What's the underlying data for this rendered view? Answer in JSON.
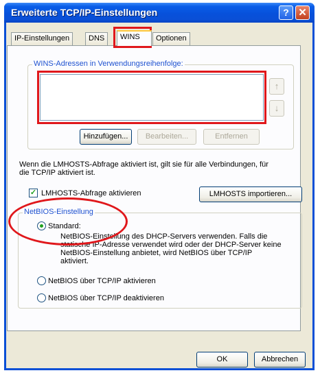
{
  "window": {
    "title": "Erweiterte TCP/IP-Einstellungen",
    "help_glyph": "?",
    "close_glyph": "✕"
  },
  "tabs": [
    {
      "label": "IP-Einstellungen",
      "active": false
    },
    {
      "label": "DNS",
      "active": false
    },
    {
      "label": "WINS",
      "active": true
    },
    {
      "label": "Optionen",
      "active": false
    }
  ],
  "wins": {
    "group_label": "WINS-Adressen in Verwendungsreihenfolge:",
    "addresses": [],
    "up_arrow": "↑",
    "down_arrow": "↓",
    "add_button": "Hinzufügen...",
    "edit_button": "Bearbeiten...",
    "remove_button": "Entfernen"
  },
  "lmhosts": {
    "description_line1": "Wenn die LMHOSTS-Abfrage aktiviert ist, gilt sie für alle Verbindungen, für",
    "description_line2": "die TCP/IP aktiviert ist.",
    "checkbox_label": "LMHOSTS-Abfrage aktivieren",
    "checked": true,
    "check_glyph": "✓",
    "import_button": "LMHOSTS importieren..."
  },
  "netbios": {
    "group_label": "NetBIOS-Einstellung",
    "options": [
      {
        "label": "Standard:",
        "selected": true
      },
      {
        "label": "NetBIOS über TCP/IP aktivieren",
        "selected": false
      },
      {
        "label": "NetBIOS über TCP/IP deaktivieren",
        "selected": false
      }
    ],
    "standard_desc_line1": "NetBIOS-Einstellung des DHCP-Servers verwenden. Falls die",
    "standard_desc_line2": "statische IP-Adresse verwendet wird oder der DHCP-Server keine",
    "standard_desc_line3": "NetBIOS-Einstellung anbietet, wird NetBIOS über TCP/IP",
    "standard_desc_line4": "aktiviert."
  },
  "footer": {
    "ok_button": "OK",
    "cancel_button": "Abbrechen"
  },
  "annotation_color": "#e0171b"
}
